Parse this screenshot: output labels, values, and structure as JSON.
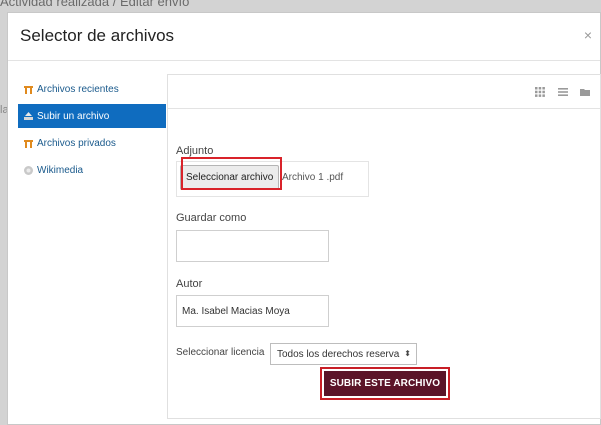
{
  "background": {
    "breadcrumb": "Actividad realizada  /  Editar envío",
    "side_text": "la"
  },
  "dialog": {
    "title": "Selector de archivos",
    "close_glyph": "×"
  },
  "sidebar": {
    "items": [
      {
        "label": "Archivos recientes",
        "icon": "recent-files-icon",
        "active": false
      },
      {
        "label": "Subir un archivo",
        "icon": "upload-icon",
        "active": true
      },
      {
        "label": "Archivos privados",
        "icon": "private-files-icon",
        "active": false
      },
      {
        "label": "Wikimedia",
        "icon": "wikimedia-icon",
        "active": false
      }
    ]
  },
  "toolbar": {
    "views": [
      "grid-view-icon",
      "list-view-icon",
      "folder-view-icon"
    ]
  },
  "form": {
    "attachment_label": "Adjunto",
    "choose_file_button": "Seleccionar archivo",
    "chosen_file": "Archivo 1 .pdf",
    "save_as_label": "Guardar como",
    "save_as_value": "",
    "author_label": "Autor",
    "author_value": "Ma. Isabel Macias Moya",
    "license_label": "Seleccionar licencia",
    "license_value": "Todos los derechos reserva",
    "submit_button": "SUBIR ESTE ARCHIVO"
  },
  "colors": {
    "active_item": "#0f6cbf",
    "submit_bg": "#5b1428",
    "highlight": "#d9232a"
  }
}
